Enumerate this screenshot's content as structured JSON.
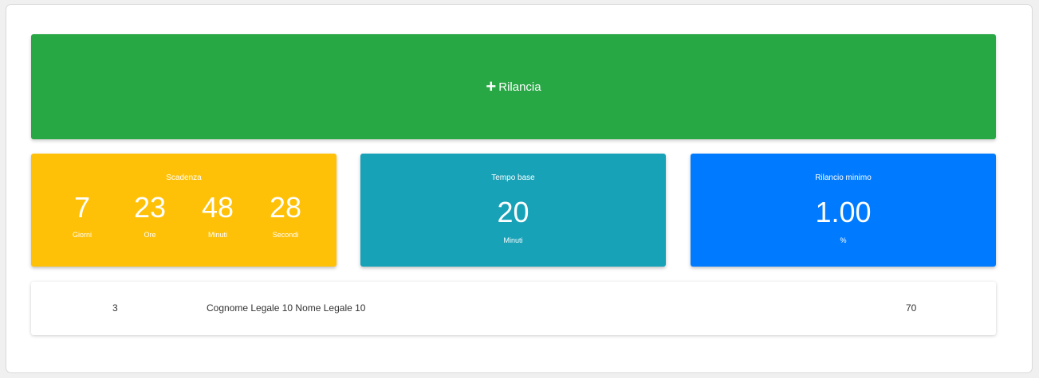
{
  "bid_button": {
    "label": "Rilancia",
    "icon": "plus-icon"
  },
  "countdown": {
    "title": "Scadenza",
    "units": [
      {
        "value": "7",
        "label": "Giorni"
      },
      {
        "value": "23",
        "label": "Ore"
      },
      {
        "value": "48",
        "label": "Minuti"
      },
      {
        "value": "28",
        "label": "Secondi"
      }
    ],
    "color": "#ffc107"
  },
  "base_time": {
    "title": "Tempo base",
    "value": "20",
    "unit": "Minuti",
    "color": "#17a2b8"
  },
  "min_raise": {
    "title": "Rilancio minimo",
    "value": "1.00",
    "unit": "%",
    "color": "#007bff"
  },
  "bid_row": {
    "rank": "3",
    "name": "Cognome Legale 10 Nome Legale 10",
    "amount": "70"
  },
  "colors": {
    "bid_green": "#28a745"
  }
}
